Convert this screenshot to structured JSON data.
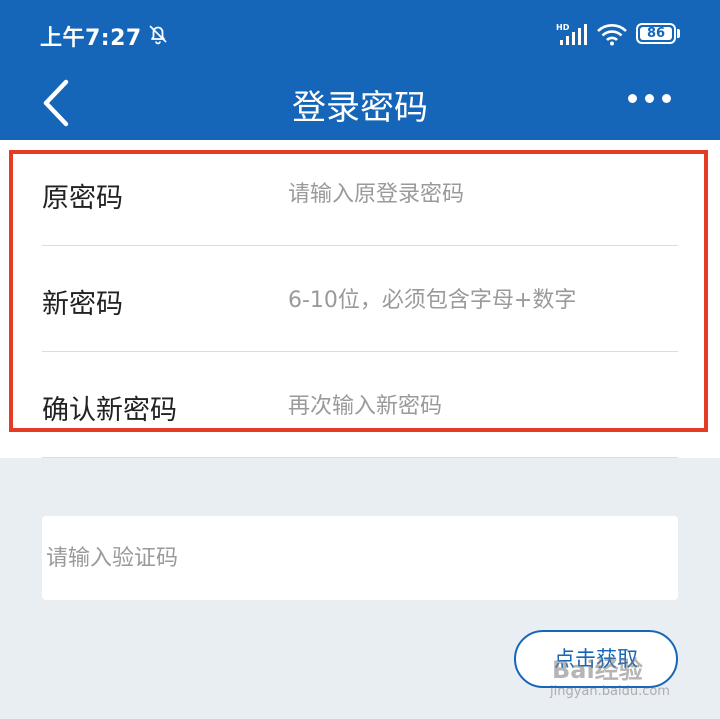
{
  "status_bar": {
    "time": "上午7:27",
    "battery": "86",
    "icons": [
      "bell-off-icon",
      "hd-signal-icon",
      "wifi-icon",
      "battery-icon"
    ]
  },
  "nav": {
    "title": "登录密码",
    "back_icon": "chevron-left-icon",
    "more_icon": "more-dots-icon"
  },
  "form": {
    "rows": [
      {
        "label": "原密码",
        "placeholder": "请输入原登录密码"
      },
      {
        "label": "新密码",
        "placeholder": "6-10位，必须包含字母+数字"
      },
      {
        "label": "确认新密码",
        "placeholder": "再次输入新密码"
      }
    ]
  },
  "verification": {
    "placeholder": "请输入验证码",
    "button_label": "点击获取"
  },
  "watermark": {
    "brand": "Bai经验",
    "url": "jingyan.baidu.com"
  },
  "colors": {
    "primary": "#1565b8",
    "highlight": "#e53a23",
    "background": "#e9eef3"
  }
}
